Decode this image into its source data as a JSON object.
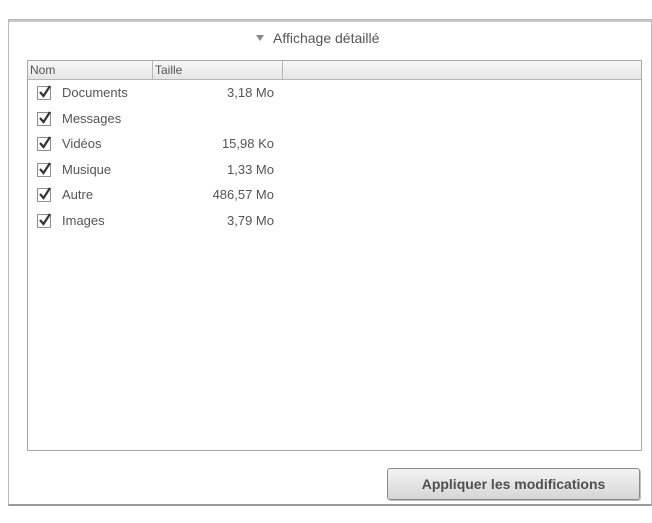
{
  "details": {
    "toggle_icon": "triangle-down-icon",
    "label": "Affichage détaillé"
  },
  "list": {
    "columns": [
      {
        "label": "Nom"
      },
      {
        "label": "Taille"
      },
      {
        "label": ""
      }
    ],
    "rows": [
      {
        "name": "Documents",
        "size": "3,18 Mo",
        "checked": true
      },
      {
        "name": "Messages",
        "size": "",
        "checked": true
      },
      {
        "name": "Vidéos",
        "size": "15,98 Ko",
        "checked": true
      },
      {
        "name": "Musique",
        "size": "1,33 Mo",
        "checked": true
      },
      {
        "name": "Autre",
        "size": "486,57 Mo",
        "checked": true
      },
      {
        "name": "Images",
        "size": "3,79 Mo",
        "checked": true
      }
    ]
  },
  "actions": {
    "apply_label": "Appliquer les modifications"
  }
}
